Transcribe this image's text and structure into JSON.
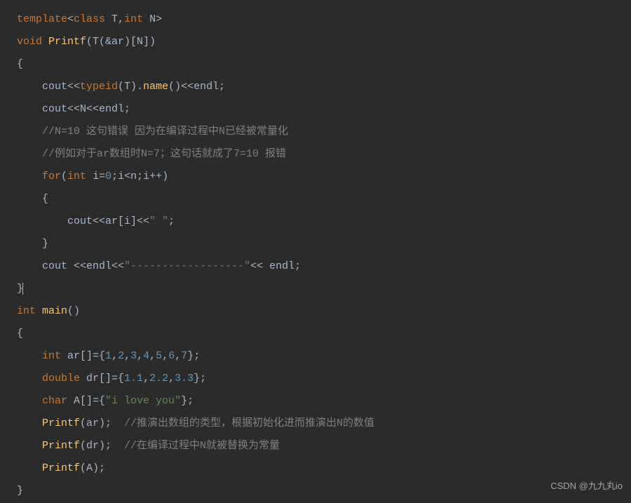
{
  "watermark": "CSDN @九九丸io",
  "chart_data": {
    "type": "table",
    "language": "cpp",
    "lines": [
      {
        "indent": 0,
        "tokens": [
          {
            "t": "kw",
            "v": "template"
          },
          {
            "t": "d",
            "v": "<"
          },
          {
            "t": "kw",
            "v": "class"
          },
          {
            "t": "d",
            "v": " T,"
          },
          {
            "t": "kw",
            "v": "int"
          },
          {
            "t": "d",
            "v": " N>"
          }
        ]
      },
      {
        "indent": 0,
        "tokens": [
          {
            "t": "kw",
            "v": "void"
          },
          {
            "t": "d",
            "v": " "
          },
          {
            "t": "fn",
            "v": "Printf"
          },
          {
            "t": "d",
            "v": "(T(&ar)[N])"
          }
        ]
      },
      {
        "indent": 0,
        "tokens": [
          {
            "t": "d",
            "v": "{"
          }
        ]
      },
      {
        "indent": 1,
        "tokens": [
          {
            "t": "d",
            "v": "cout<<"
          },
          {
            "t": "kw",
            "v": "typeid"
          },
          {
            "t": "d",
            "v": "(T)."
          },
          {
            "t": "fn",
            "v": "name"
          },
          {
            "t": "d",
            "v": "()<<endl;"
          }
        ]
      },
      {
        "indent": 1,
        "tokens": [
          {
            "t": "d",
            "v": "cout<<N<<endl;"
          }
        ]
      },
      {
        "indent": 1,
        "tokens": [
          {
            "t": "cmt",
            "v": "//N=10 这句错误 因为在编译过程中N已经被常量化"
          }
        ]
      },
      {
        "indent": 1,
        "tokens": [
          {
            "t": "cmt",
            "v": "//例如对于ar数组时N=7；这句话就成了7=10 报错"
          }
        ]
      },
      {
        "indent": 1,
        "tokens": [
          {
            "t": "kw",
            "v": "for"
          },
          {
            "t": "d",
            "v": "("
          },
          {
            "t": "kw",
            "v": "int"
          },
          {
            "t": "d",
            "v": " i="
          },
          {
            "t": "num",
            "v": "0"
          },
          {
            "t": "d",
            "v": ";i<n;i++)"
          }
        ]
      },
      {
        "indent": 1,
        "tokens": [
          {
            "t": "d",
            "v": "{"
          }
        ]
      },
      {
        "indent": 2,
        "tokens": [
          {
            "t": "d",
            "v": "cout<<ar[i]<<"
          },
          {
            "t": "str",
            "v": "\" \""
          },
          {
            "t": "d",
            "v": ";"
          }
        ]
      },
      {
        "indent": 1,
        "tokens": [
          {
            "t": "d",
            "v": "}"
          }
        ]
      },
      {
        "indent": 1,
        "tokens": [
          {
            "t": "d",
            "v": "cout <<endl<<"
          },
          {
            "t": "str",
            "v": "\"------------------\""
          },
          {
            "t": "d",
            "v": "<< endl;"
          }
        ]
      },
      {
        "indent": 0,
        "tokens": [
          {
            "t": "d",
            "v": "}"
          },
          {
            "t": "cursor",
            "v": ""
          }
        ]
      },
      {
        "indent": 0,
        "tokens": [
          {
            "t": "kw",
            "v": "int"
          },
          {
            "t": "d",
            "v": " "
          },
          {
            "t": "fn",
            "v": "main"
          },
          {
            "t": "d",
            "v": "()"
          }
        ]
      },
      {
        "indent": 0,
        "tokens": [
          {
            "t": "d",
            "v": "{"
          }
        ]
      },
      {
        "indent": 1,
        "tokens": [
          {
            "t": "kw",
            "v": "int"
          },
          {
            "t": "d",
            "v": " ar[]={"
          },
          {
            "t": "num",
            "v": "1"
          },
          {
            "t": "d",
            "v": ","
          },
          {
            "t": "num",
            "v": "2"
          },
          {
            "t": "d",
            "v": ","
          },
          {
            "t": "num",
            "v": "3"
          },
          {
            "t": "d",
            "v": ","
          },
          {
            "t": "num",
            "v": "4"
          },
          {
            "t": "d",
            "v": ","
          },
          {
            "t": "num",
            "v": "5"
          },
          {
            "t": "d",
            "v": ","
          },
          {
            "t": "num",
            "v": "6"
          },
          {
            "t": "d",
            "v": ","
          },
          {
            "t": "num",
            "v": "7"
          },
          {
            "t": "d",
            "v": "};"
          }
        ]
      },
      {
        "indent": 1,
        "tokens": [
          {
            "t": "kw",
            "v": "double"
          },
          {
            "t": "d",
            "v": " dr[]={"
          },
          {
            "t": "num",
            "v": "1.1"
          },
          {
            "t": "d",
            "v": ","
          },
          {
            "t": "num",
            "v": "2.2"
          },
          {
            "t": "d",
            "v": ","
          },
          {
            "t": "num",
            "v": "3.3"
          },
          {
            "t": "d",
            "v": "};"
          }
        ]
      },
      {
        "indent": 1,
        "tokens": [
          {
            "t": "kw",
            "v": "char"
          },
          {
            "t": "d",
            "v": " A[]={"
          },
          {
            "t": "str",
            "v": "\"i love you\""
          },
          {
            "t": "d",
            "v": "};"
          }
        ]
      },
      {
        "indent": 1,
        "tokens": [
          {
            "t": "fn",
            "v": "Printf"
          },
          {
            "t": "d",
            "v": "(ar);  "
          },
          {
            "t": "cmt",
            "v": "//推演出数组的类型，根据初始化进而推演出N的数值"
          }
        ]
      },
      {
        "indent": 1,
        "tokens": [
          {
            "t": "fn",
            "v": "Printf"
          },
          {
            "t": "d",
            "v": "(dr);  "
          },
          {
            "t": "cmt",
            "v": "//在编译过程中N就被替换为常量"
          }
        ]
      },
      {
        "indent": 1,
        "tokens": [
          {
            "t": "fn",
            "v": "Printf"
          },
          {
            "t": "d",
            "v": "(A);"
          }
        ]
      },
      {
        "indent": 0,
        "tokens": [
          {
            "t": "d",
            "v": "}"
          }
        ]
      }
    ]
  }
}
